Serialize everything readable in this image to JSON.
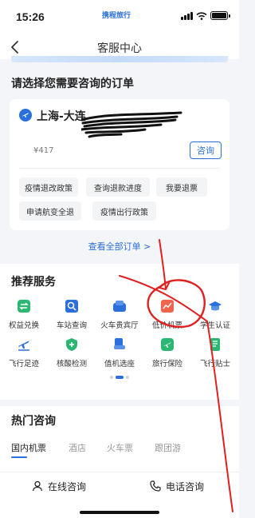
{
  "status_bar": {
    "time": "15:26",
    "brand": "携程旅行"
  },
  "nav": {
    "title": "客服中心"
  },
  "orders": {
    "section_title": "请选择您需要咨询的订单",
    "card": {
      "route": "上海-大连",
      "price": "¥417",
      "consult_label": "咨询",
      "chips": [
        "疫情退改政策",
        "查询退款进度",
        "我要退票",
        "申请航变全退",
        "疫情出行政策"
      ]
    },
    "view_all_label": "查看全部订单 >"
  },
  "services": {
    "section_title": "推荐服务",
    "items": [
      {
        "label": "权益兑换",
        "icon": "exchange-icon",
        "color": "#2bb673"
      },
      {
        "label": "车站查询",
        "icon": "station-search-icon",
        "color": "#2a6fdb"
      },
      {
        "label": "火车贵宾厅",
        "icon": "vip-lounge-icon",
        "color": "#2a6fdb"
      },
      {
        "label": "低价机票",
        "icon": "low-price-ticket-icon",
        "color": "#f0654d"
      },
      {
        "label": "学生认证",
        "icon": "graduation-cap-icon",
        "color": "#2a6fdb"
      },
      {
        "label": "飞行足迹",
        "icon": "plane-trail-icon",
        "color": "#2a6fdb"
      },
      {
        "label": "核酸检测",
        "icon": "shield-plus-icon",
        "color": "#2bb673"
      },
      {
        "label": "值机选座",
        "icon": "seat-icon",
        "color": "#2a6fdb"
      },
      {
        "label": "旅行保险",
        "icon": "insurance-plane-icon",
        "color": "#2bb673"
      },
      {
        "label": "飞行贴士",
        "icon": "tips-book-icon",
        "color": "#2bb673"
      }
    ]
  },
  "hot": {
    "section_title": "热门咨询",
    "tabs": [
      "国内机票",
      "酒店",
      "火车票",
      "跟团游"
    ]
  },
  "bottom": {
    "online_label": "在线咨询",
    "phone_label": "电话咨询"
  },
  "colors": {
    "accent": "#2a6fdb",
    "annotation": "#e02020"
  }
}
